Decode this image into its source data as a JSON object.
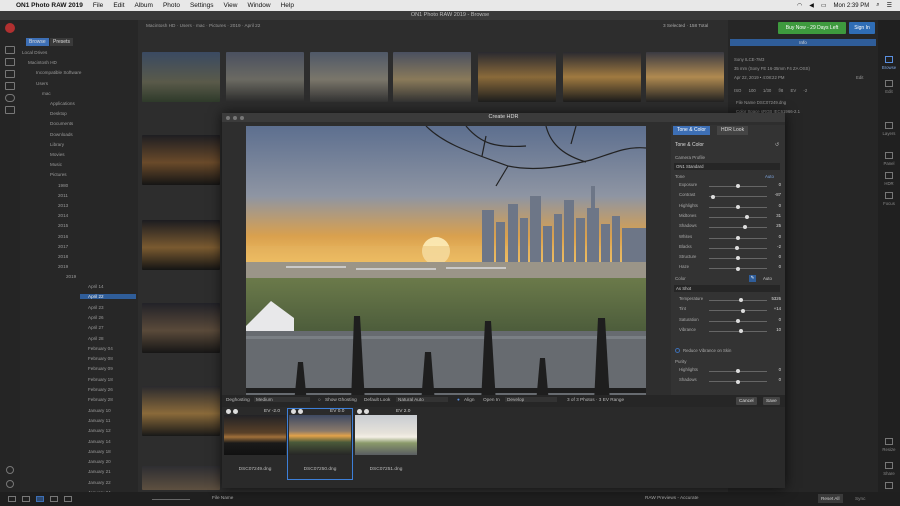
{
  "menubar": {
    "app": "ON1 Photo RAW 2019",
    "items": [
      "File",
      "Edit",
      "Album",
      "Photo",
      "Settings",
      "View",
      "Window",
      "Help"
    ],
    "clock": "Mon 2:39 PM"
  },
  "window_title": "ON1 Photo RAW 2019 - Browse",
  "left_tabs": [
    "Browse",
    "Presets"
  ],
  "breadcrumb": "Macintosh HD · Users · mac · Pictures · 2019 · April 22",
  "selection_info": "3 Selected · 158 Total",
  "buy_button": "Buy Now - 29 Days Left",
  "signin_button": "Sign In",
  "folders": {
    "top": [
      "Local Drives",
      "Macintosh HD",
      "Incompatible Software",
      "Users",
      "mac",
      "Applications",
      "Desktop",
      "Documents",
      "Downloads",
      "Library",
      "Movies",
      "Music",
      "Pictures",
      "1980",
      "2011",
      "2013",
      "2014",
      "2015",
      "2016",
      "2017",
      "2018",
      "2019",
      "2019"
    ],
    "dates": [
      "April 14",
      "April 22",
      "April 23",
      "April 26",
      "April 27",
      "April 28",
      "February 04",
      "February 08",
      "February 09",
      "February 18",
      "February 26",
      "February 28",
      "January 10",
      "January 11",
      "January 12",
      "January 14",
      "January 18",
      "January 20",
      "January 21",
      "January 22",
      "January 24",
      "January 26",
      "January 27"
    ]
  },
  "right_rail": [
    "Browse",
    "Edit",
    "Layers",
    "Panel",
    "HDR",
    "Focus",
    "Resize",
    "Share",
    "Export"
  ],
  "info_panel": {
    "header": "Info",
    "lines": [
      "Sony ILCE-7M3",
      "35 mm (Sony FE 16-35mm F4 ZA OSS)",
      "Apr 22, 2019 • 4:08:22 PM",
      "ISO 100   1/30   f/8   EV -2",
      "File Name DSC07249.dng",
      "Color Space sRGB IEC61966-2.1"
    ],
    "edit_label": "Edit"
  },
  "dialog": {
    "title": "Create HDR",
    "tabs": [
      "Tone & Color",
      "HDR Look"
    ],
    "section": "Tone & Color",
    "camera_profile_label": "Camera Profile",
    "camera_profile_value": "ON1 Standard",
    "tone_label": "Tone",
    "auto_label": "Auto",
    "tone_sliders": [
      {
        "label": "Exposure",
        "value": "0",
        "pos": 0.5
      },
      {
        "label": "Contrast",
        "value": "-87",
        "pos": 0.07
      },
      {
        "label": "Highlights",
        "value": "0",
        "pos": 0.5
      },
      {
        "label": "Midtones",
        "value": "31",
        "pos": 0.66
      },
      {
        "label": "Shadows",
        "value": "25",
        "pos": 0.62
      },
      {
        "label": "Whites",
        "value": "0",
        "pos": 0.5
      },
      {
        "label": "Blacks",
        "value": "-2",
        "pos": 0.49
      },
      {
        "label": "Structure",
        "value": "0",
        "pos": 0.5
      },
      {
        "label": "Haze",
        "value": "0",
        "pos": 0.5
      }
    ],
    "color_label": "Color",
    "wb_value": "As Shot",
    "color_sliders": [
      {
        "label": "Temperature",
        "value": "5326",
        "pos": 0.55
      },
      {
        "label": "Tint",
        "value": "+14",
        "pos": 0.58
      },
      {
        "label": "Saturation",
        "value": "0",
        "pos": 0.5
      },
      {
        "label": "Vibrance",
        "value": "10",
        "pos": 0.56
      }
    ],
    "reduce_vibrance": "Reduce Vibrance on Skin",
    "purity_label": "Purity",
    "purity_sliders": [
      {
        "label": "Highlights",
        "value": "0",
        "pos": 0.5
      },
      {
        "label": "Shadows",
        "value": "0",
        "pos": 0.5
      }
    ],
    "toolbar": {
      "deghosting_label": "Deghosting",
      "deghosting_value": "Medium",
      "show_ghosting": "Show Ghosting",
      "default_look": "Default Look",
      "natural_auto": "Natural Auto",
      "align": "Align",
      "open_in": "Open In",
      "open_in_value": "Develop",
      "summary": "3 of 3 Photos · 3 EV Range",
      "cancel": "Cancel",
      "save": "Save"
    },
    "film": [
      {
        "ev": "EV -2.0",
        "name": "DSC07249.dng"
      },
      {
        "ev": "EV 0.0",
        "name": "DSC07250.dng"
      },
      {
        "ev": "EV 2.0",
        "name": "DSC07251.dng"
      }
    ]
  },
  "bottombar": {
    "sort": "File Name",
    "previews": "RAW Previews - Accurate",
    "reset": "Reset All",
    "sync": "Sync"
  }
}
